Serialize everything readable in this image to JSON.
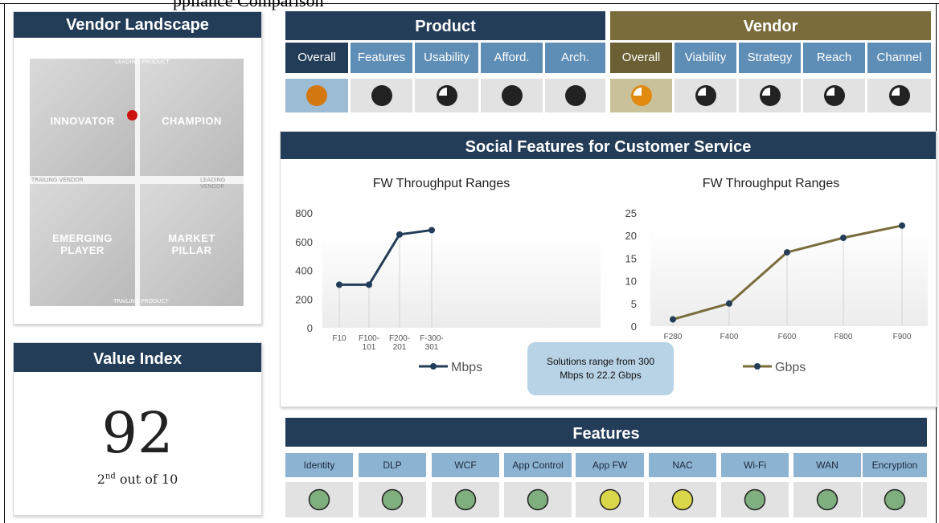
{
  "top_fragment": "ppliance Comparison",
  "vendor_landscape": {
    "title": "Vendor Landscape",
    "quadrants": {
      "innovator": "INNOVATOR",
      "champion": "CHAMPION",
      "emerging": "EMERGING PLAYER",
      "pillar": "MARKET PILLAR"
    },
    "axes": {
      "top": "LEADING PRODUCT",
      "bottom": "TRAILING PRODUCT",
      "left": "TRAILING VENDOR",
      "right": "LEADING VENDOR"
    },
    "marker_color": "#cc1111"
  },
  "value_index": {
    "title": "Value Index",
    "score": "92",
    "rank_number": "2",
    "rank_suffix": "nd",
    "rank_rest": " out of 10"
  },
  "product": {
    "title": "Product",
    "tabs": [
      "Overall",
      "Features",
      "Usability",
      "Afford.",
      "Arch."
    ],
    "ratings": [
      {
        "icon": "orange-full-circle-icon",
        "level": 1.0
      },
      {
        "icon": "full-circle-icon",
        "level": 1.0
      },
      {
        "icon": "three-quarter-circle-icon",
        "level": 0.75
      },
      {
        "icon": "full-circle-icon",
        "level": 1.0
      },
      {
        "icon": "full-circle-icon",
        "level": 1.0
      }
    ]
  },
  "vendor": {
    "title": "Vendor",
    "tabs": [
      "Overall",
      "Viability",
      "Strategy",
      "Reach",
      "Channel"
    ],
    "ratings": [
      {
        "icon": "orange-three-quarter-circle-icon",
        "level": 0.75
      },
      {
        "icon": "three-quarter-circle-icon",
        "level": 0.75
      },
      {
        "icon": "three-quarter-circle-icon",
        "level": 0.75
      },
      {
        "icon": "three-quarter-circle-icon",
        "level": 0.75
      },
      {
        "icon": "three-quarter-circle-icon",
        "level": 0.75
      }
    ]
  },
  "social": {
    "title": "Social Features for Customer Service",
    "callout": "Solutions range from 300 Mbps to 22.2 Gbps"
  },
  "chart_data": [
    {
      "type": "line",
      "title": "FW Throughput Ranges",
      "categories": [
        "F10",
        "F100-101",
        "F200-201",
        "F-300-301"
      ],
      "category_lines": [
        [
          "F10"
        ],
        [
          "F100-",
          "101"
        ],
        [
          "F200-",
          "201"
        ],
        [
          "F-300-",
          "301"
        ]
      ],
      "series": [
        {
          "name": "Mbps",
          "values": [
            300,
            300,
            650,
            680
          ]
        }
      ],
      "ylim": [
        0,
        800
      ],
      "yticks": [
        "0",
        "200",
        "400",
        "600",
        "800"
      ],
      "color": "#233d58",
      "legend": "bottom"
    },
    {
      "type": "line",
      "title": "FW Throughput Ranges",
      "categories": [
        "F280",
        "F400",
        "F600",
        "F800",
        "F900"
      ],
      "series": [
        {
          "name": "Gbps",
          "values": [
            1.5,
            5,
            16.3,
            19.5,
            22.2
          ]
        }
      ],
      "ylim": [
        0,
        25
      ],
      "yticks": [
        "0",
        "5",
        "10",
        "15",
        "20",
        "25"
      ],
      "color": "#7a6c3b",
      "legend": "bottom"
    }
  ],
  "features": {
    "title": "Features",
    "items": [
      {
        "label": "Identity",
        "status": "green"
      },
      {
        "label": "DLP",
        "status": "green"
      },
      {
        "label": "WCF",
        "status": "green"
      },
      {
        "label": "App Control",
        "status": "green"
      },
      {
        "label": "App FW",
        "status": "yellow"
      },
      {
        "label": "NAC",
        "status": "yellow"
      },
      {
        "label": "Wi-Fi",
        "status": "green"
      },
      {
        "label": "WAN",
        "status": "green"
      },
      {
        "label": "Encryption",
        "status": "green"
      }
    ],
    "colors": {
      "green": "#7fae7f",
      "yellow": "#d9d64a"
    }
  }
}
